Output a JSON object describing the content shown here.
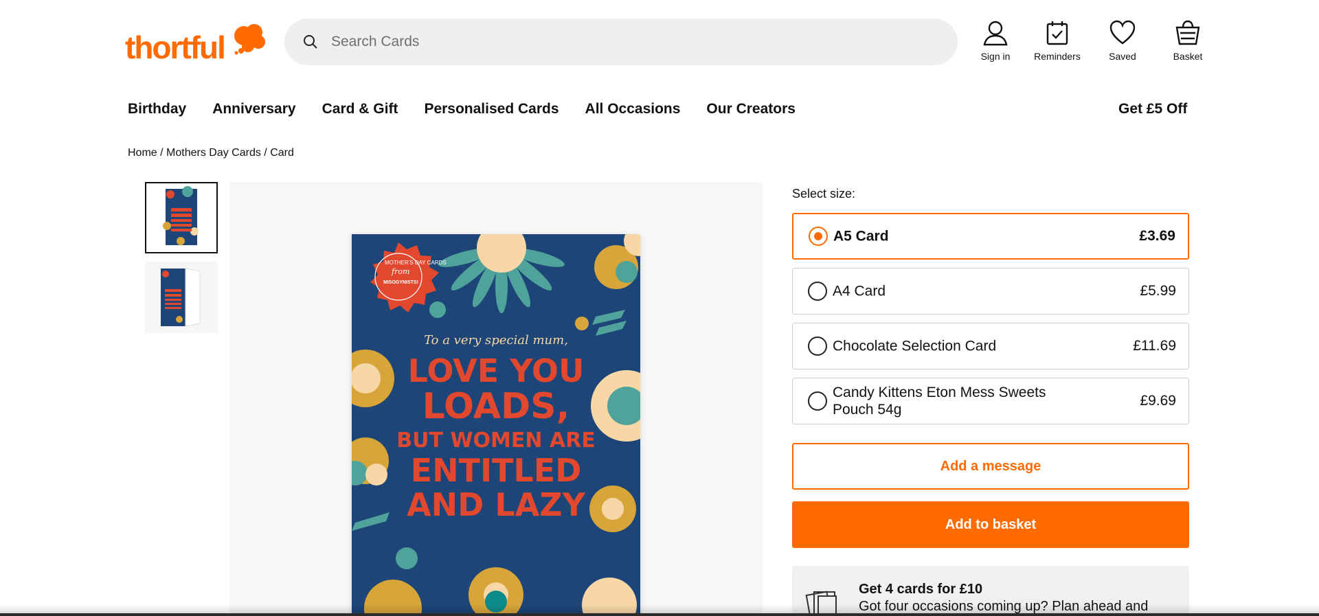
{
  "header": {
    "logo_text": "thortful",
    "search": {
      "placeholder": "Search Cards",
      "value": ""
    },
    "actions": [
      {
        "label": "Sign in",
        "icon": "user-icon"
      },
      {
        "label": "Reminders",
        "icon": "calendar-check-icon"
      },
      {
        "label": "Saved",
        "icon": "heart-icon"
      },
      {
        "label": "Basket",
        "icon": "basket-icon"
      }
    ]
  },
  "nav": {
    "items": [
      "Birthday",
      "Anniversary",
      "Card & Gift",
      "Personalised Cards",
      "All Occasions",
      "Our Creators"
    ],
    "promo": "Get £5 Off"
  },
  "breadcrumb": {
    "items": [
      "Home",
      "Mothers Day Cards",
      "Card"
    ],
    "separator": " / "
  },
  "product": {
    "card_art": {
      "badge_lines": [
        "MOTHER'S DAY CARDS",
        "from",
        "MISOGYNISTS!"
      ],
      "script_line": "To a very special mum,",
      "headline_lines": [
        "LOVE YOU",
        "LOADS,",
        "BUT WOMEN ARE",
        "ENTITLED",
        "AND LAZY"
      ]
    },
    "size_title": "Select size:",
    "options": [
      {
        "name": "A5 Card",
        "price": "£3.69",
        "selected": true
      },
      {
        "name": "A4 Card",
        "price": "£5.99",
        "selected": false
      },
      {
        "name": "Chocolate Selection Card",
        "price": "£11.69",
        "selected": false
      },
      {
        "name": "Candy Kittens Eton Mess Sweets Pouch 54g",
        "price": "£9.69",
        "selected": false
      }
    ],
    "add_message_label": "Add a message",
    "add_basket_label": "Add to basket",
    "offer": {
      "title": "Get 4 cards for £10",
      "description": "Got four occasions coming up? Plan ahead and"
    }
  },
  "colors": {
    "brand_orange": "#ff6b00",
    "card_navy": "#1d4577",
    "card_red": "#e2482e",
    "card_teal": "#4fa39b",
    "card_mustard": "#d8a53a",
    "card_cream": "#f7d7a6"
  }
}
